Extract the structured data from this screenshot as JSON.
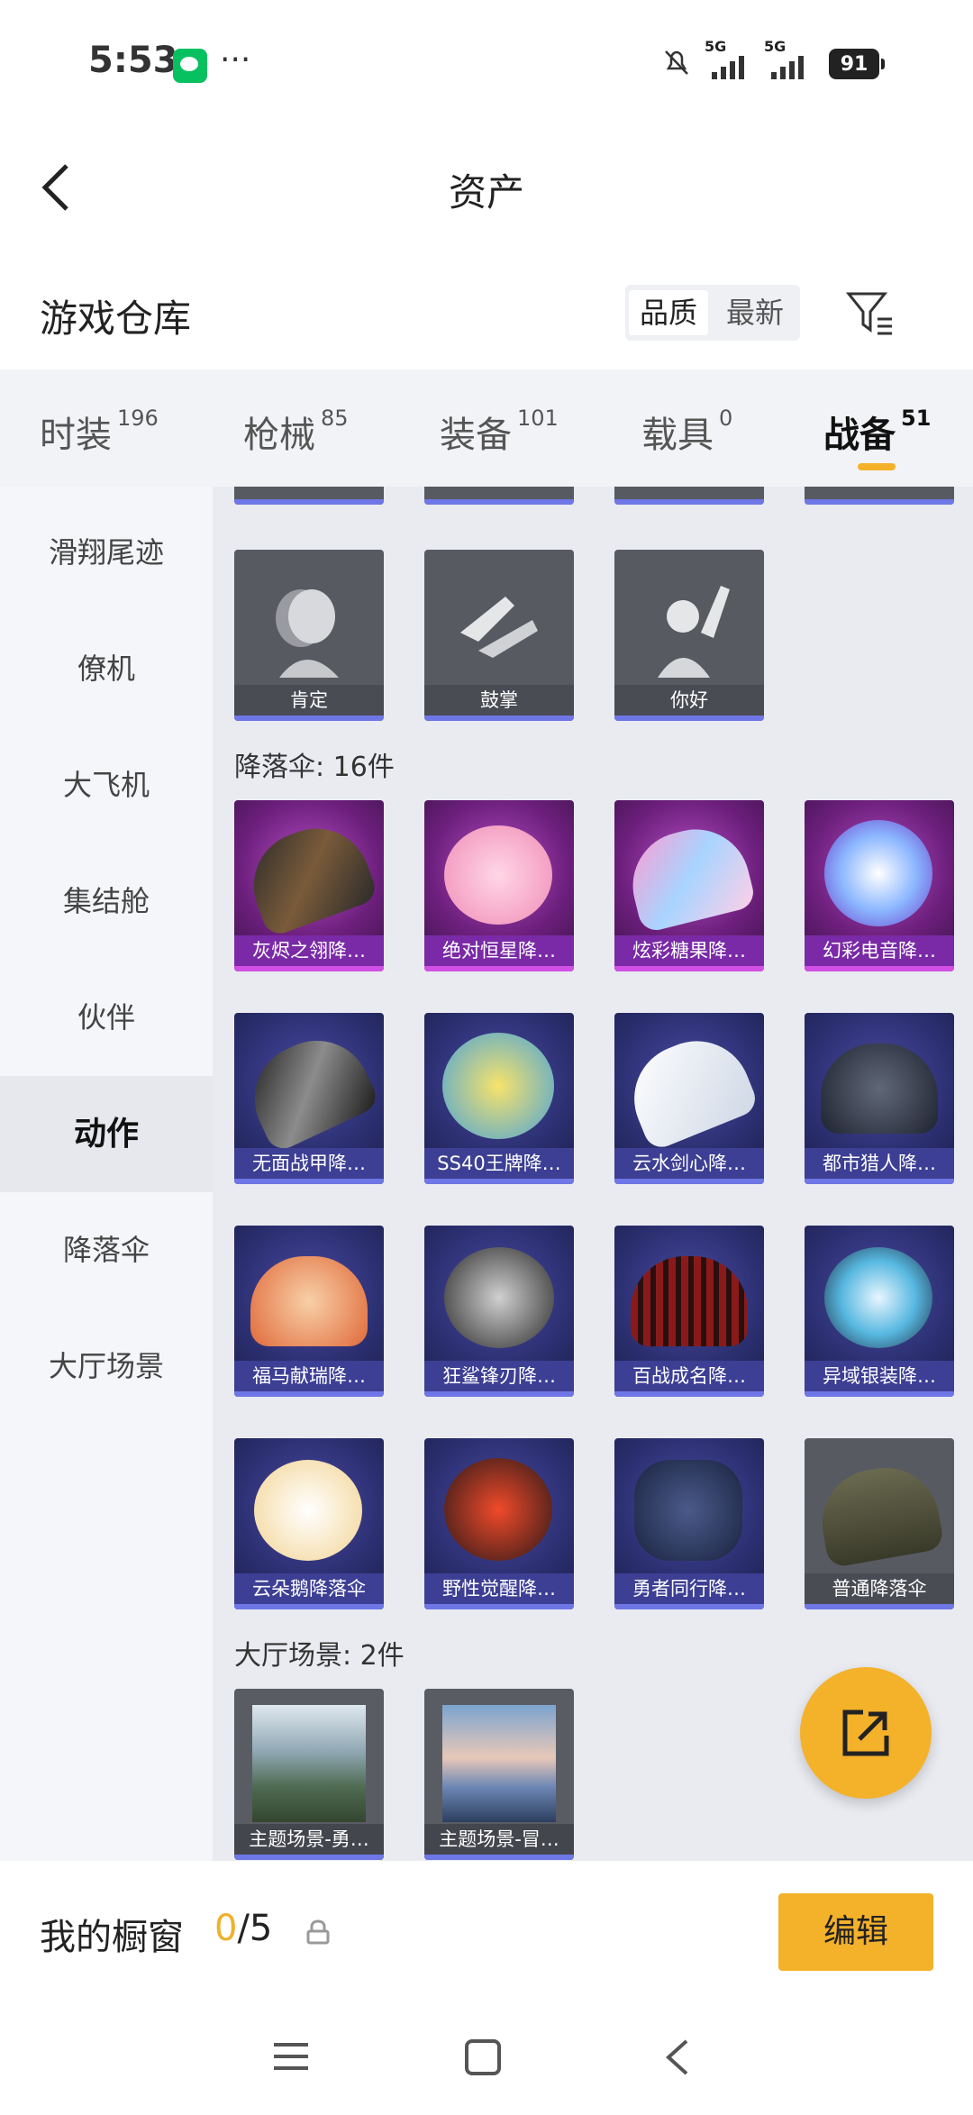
{
  "status_bar": {
    "time": "5:53",
    "network1": "5G",
    "network2": "5G",
    "battery": "91"
  },
  "header": {
    "title": "资产"
  },
  "warehouse": {
    "title": "游戏仓库",
    "sort_quality": "品质",
    "sort_latest": "最新"
  },
  "tabs": [
    {
      "label": "时装",
      "count": "196"
    },
    {
      "label": "枪械",
      "count": "85"
    },
    {
      "label": "装备",
      "count": "101"
    },
    {
      "label": "载具",
      "count": "0"
    },
    {
      "label": "战备",
      "count": "51"
    }
  ],
  "left_nav": [
    "滑翔尾迹",
    "僚机",
    "大飞机",
    "集结舱",
    "伙伴",
    "动作",
    "降落伞",
    "大厅场景"
  ],
  "content": {
    "actions": [
      "肯定",
      "鼓掌",
      "你好"
    ],
    "parachutes_heading": "降落伞: 16件",
    "parachutes": [
      "灰烬之翎降…",
      "绝对恒星降…",
      "炫彩糖果降…",
      "幻彩电音降…",
      "无面战甲降…",
      "SS40王牌降…",
      "云水剑心降…",
      "都市猎人降…",
      "福马献瑞降…",
      "狂鲨锋刃降…",
      "百战成名降…",
      "异域银装降…",
      "云朵鹅降落伞",
      "野性觉醒降…",
      "勇者同行降…",
      "普通降落伞"
    ],
    "lobby_heading": "大厅场景: 2件",
    "lobby": [
      "主题场景-勇…",
      "主题场景-冒…"
    ]
  },
  "bottom": {
    "title": "我的橱窗",
    "used": "0",
    "total": "/5",
    "edit_label": "编辑"
  },
  "colors": {
    "accent": "#f4b12a",
    "purple_card": "#7a2aa6",
    "blue_card": "#3d3f94"
  }
}
